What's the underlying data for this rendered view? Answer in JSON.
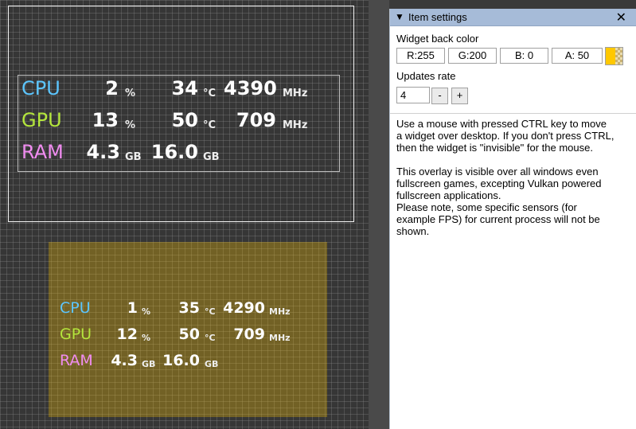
{
  "widget1": {
    "cpu": {
      "label": "CPU",
      "load": "2",
      "load_unit": "%",
      "temp": "34",
      "temp_unit": "°C",
      "freq": "4390",
      "freq_unit": "MHz"
    },
    "gpu": {
      "label": "GPU",
      "load": "13",
      "load_unit": "%",
      "temp": "50",
      "temp_unit": "°C",
      "freq": "709",
      "freq_unit": "MHz"
    },
    "ram": {
      "label": "RAM",
      "used": "4.3",
      "used_unit": "GB",
      "total": "16.0",
      "total_unit": "GB"
    }
  },
  "widget2": {
    "cpu": {
      "label": "CPU",
      "load": "1",
      "load_unit": "%",
      "temp": "35",
      "temp_unit": "°C",
      "freq": "4290",
      "freq_unit": "MHz"
    },
    "gpu": {
      "label": "GPU",
      "load": "12",
      "load_unit": "%",
      "temp": "50",
      "temp_unit": "°C",
      "freq": "709",
      "freq_unit": "MHz"
    },
    "ram": {
      "label": "RAM",
      "used": "4.3",
      "used_unit": "GB",
      "total": "16.0",
      "total_unit": "GB"
    }
  },
  "panel": {
    "title": "Item settings",
    "collapse_icon": "▼",
    "close_icon": "✕",
    "back_color_label": "Widget back color",
    "color": {
      "r": "R:255",
      "g": "G:200",
      "b": "B:  0",
      "a": "A: 50",
      "swatch": "#ffc800"
    },
    "updates_label": "Updates rate",
    "updates_value": "4",
    "minus": "-",
    "plus": "+",
    "help1_l1": "Use a mouse with pressed CTRL key to move",
    "help1_l2": "a widget over desktop. If you don't press CTRL,",
    "help1_l3": "then the widget is \"invisible\" for the mouse.",
    "help2_l1": "This overlay is visible over all windows even",
    "help2_l2": "fullscreen games, excepting Vulkan powered",
    "help2_l3": "fullscreen applications.",
    "help2_l4": "Please note, some specific sensors (for",
    "help2_l5": "example FPS) for current process will not be",
    "help2_l6": "shown."
  }
}
